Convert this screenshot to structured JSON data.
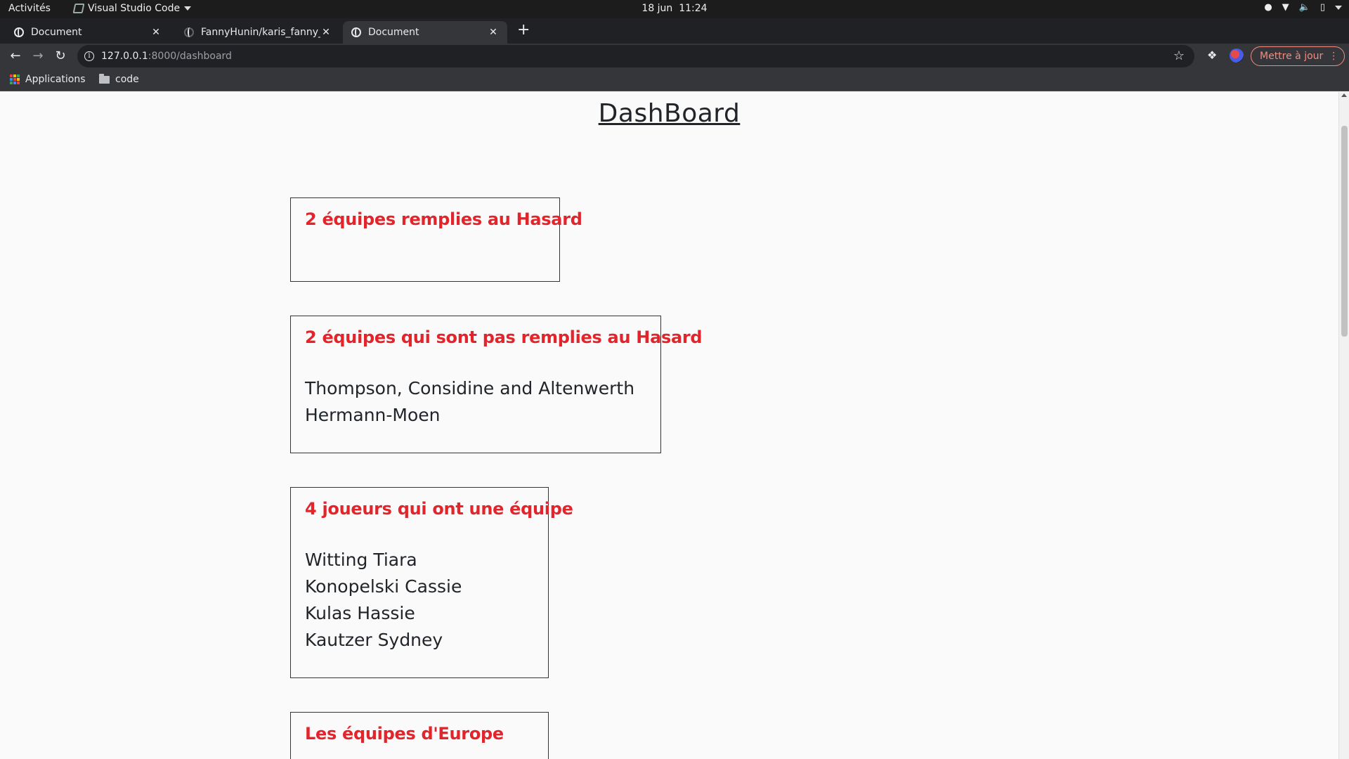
{
  "os_bar": {
    "activities": "Activités",
    "app_name": "Visual Studio Code",
    "date": "18 jun",
    "time": "11:24"
  },
  "tabs": [
    {
      "title": "Document",
      "icon": "globe-icon",
      "active": false
    },
    {
      "title": "FannyHunin/karis_fanny_",
      "icon": "github-icon",
      "active": false
    },
    {
      "title": "Document",
      "icon": "globe-icon",
      "active": true
    }
  ],
  "toolbar": {
    "url_host": "127.0.0.1",
    "url_rest": ":8000/dashboard",
    "update_label": "Mettre à jour"
  },
  "bookmarks": [
    {
      "label": "Applications",
      "icon": "apps-grid-icon"
    },
    {
      "label": "code",
      "icon": "folder-icon"
    }
  ],
  "page": {
    "title": "DashBoard",
    "cards": [
      {
        "heading": "2 équipes remplies au Hasard",
        "items": []
      },
      {
        "heading": "2 équipes qui sont pas remplies au Hasard",
        "items": [
          "Thompson, Considine and Altenwerth",
          "Hermann-Moen"
        ]
      },
      {
        "heading": "4 joueurs qui ont une équipe",
        "items": [
          "Witting Tiara",
          "Konopelski Cassie",
          "Kulas Hassie",
          "Kautzer Sydney"
        ]
      },
      {
        "heading": "Les équipes d'Europe",
        "items": []
      }
    ]
  },
  "colors": {
    "heading_red": "#e3242b",
    "text_dark": "#212529",
    "browser_dark": "#35363a",
    "update_accent": "#f28b82"
  }
}
